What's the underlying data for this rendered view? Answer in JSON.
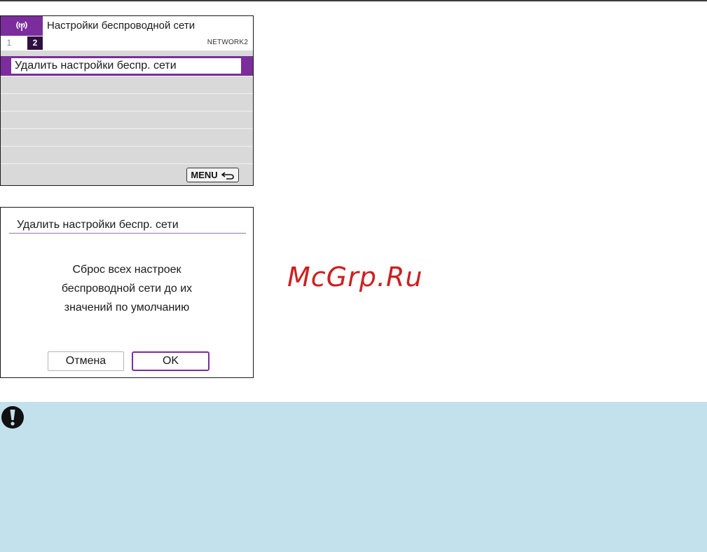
{
  "menu_screen": {
    "title": "Настройки беспроводной сети",
    "tabs": [
      "1",
      "2"
    ],
    "page_code": "NETWORK2",
    "selected_item": "Удалить настройки беспр. сети",
    "empty_rows": 5,
    "back_button": "MENU",
    "accent_color": "#7b2d9c"
  },
  "dialog_screen": {
    "title": "Удалить настройки беспр. сети",
    "message_lines": [
      "Сброс всех настроек",
      "беспроводной сети до их",
      "значений по умолчанию"
    ],
    "cancel_label": "Отмена",
    "ok_label": "OK"
  },
  "watermark": "McGrp.Ru",
  "caution": {
    "icon": "caution-icon",
    "background": "#c3e1ed"
  }
}
